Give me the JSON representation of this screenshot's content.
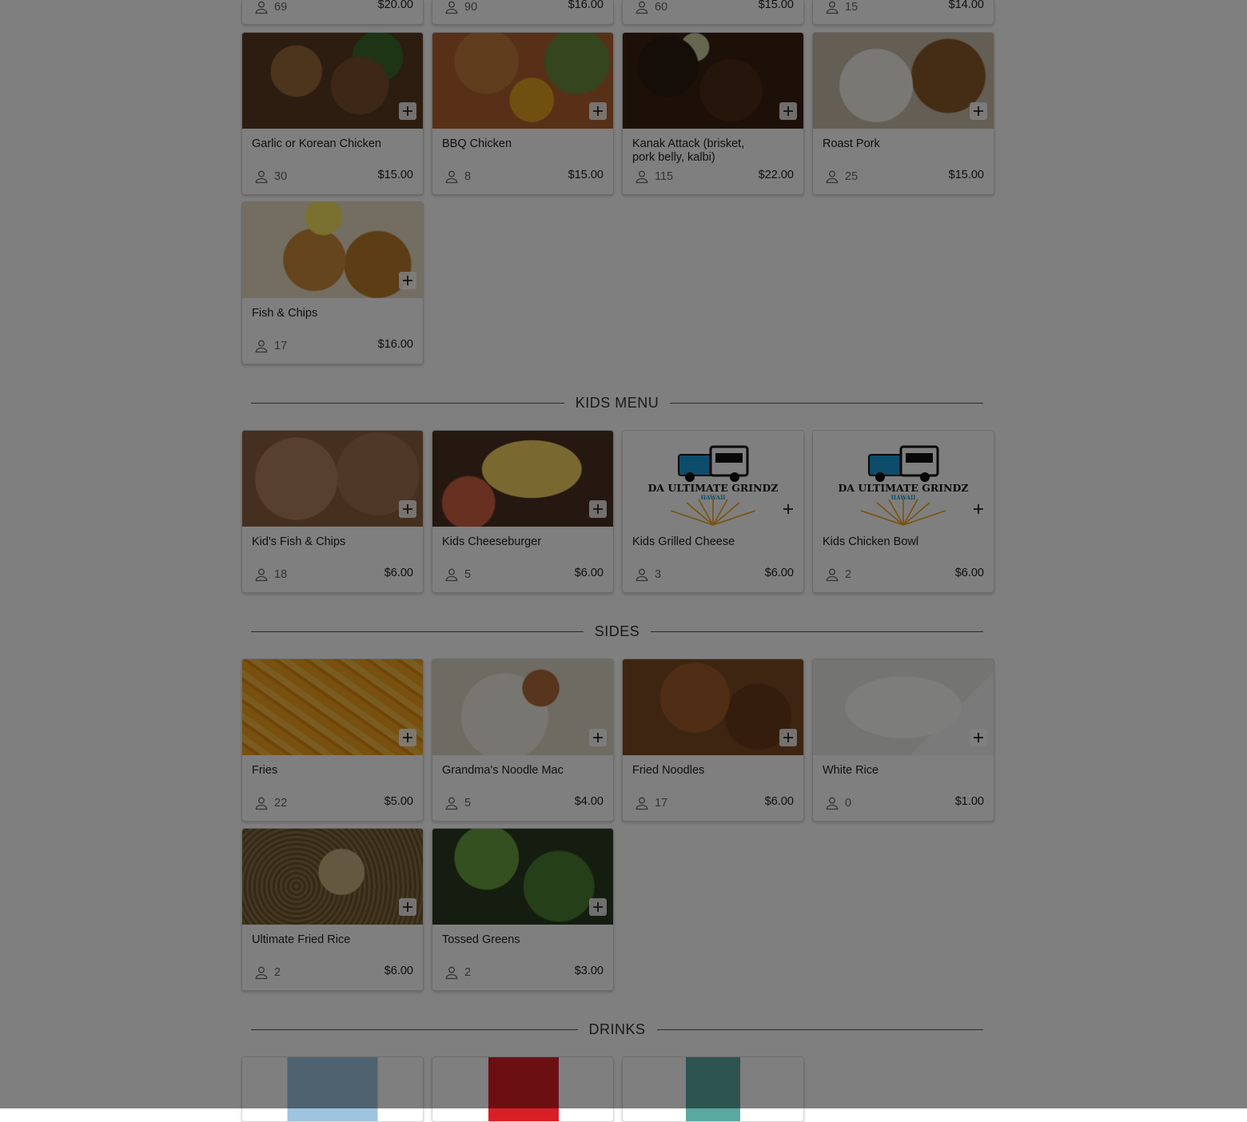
{
  "top_row": [
    {
      "count": "69",
      "price": "$20.00"
    },
    {
      "count": "90",
      "price": "$16.00"
    },
    {
      "count": "60",
      "price": "$15.00"
    },
    {
      "count": "15",
      "price": "$14.00"
    }
  ],
  "mains": [
    {
      "name": "Garlic or Korean Chicken",
      "count": "30",
      "price": "$15.00"
    },
    {
      "name": "BBQ Chicken",
      "count": "8",
      "price": "$15.00"
    },
    {
      "name": "Kanak Attack (brisket, pork belly, kalbi)",
      "count": "115",
      "price": "$22.00"
    },
    {
      "name": "Roast Pork",
      "count": "25",
      "price": "$15.00"
    },
    {
      "name": "Fish & Chips",
      "count": "17",
      "price": "$16.00"
    }
  ],
  "kids_menu": {
    "title": "KIDS MENU",
    "items": [
      {
        "name": "Kid's Fish & Chips",
        "count": "18",
        "price": "$6.00"
      },
      {
        "name": "Kids Cheeseburger",
        "count": "5",
        "price": "$6.00"
      },
      {
        "name": "Kids Grilled Cheese",
        "count": "3",
        "price": "$6.00"
      },
      {
        "name": "Kids Chicken Bowl",
        "count": "2",
        "price": "$6.00"
      }
    ]
  },
  "sides": {
    "title": "SIDES",
    "items": [
      {
        "name": "Fries",
        "count": "22",
        "price": "$5.00"
      },
      {
        "name": "Grandma's Noodle Mac",
        "count": "5",
        "price": "$4.00"
      },
      {
        "name": "Fried Noodles",
        "count": "17",
        "price": "$6.00"
      },
      {
        "name": "White Rice",
        "count": "0",
        "price": "$1.00"
      },
      {
        "name": "Ultimate Fried Rice",
        "count": "2",
        "price": "$6.00"
      },
      {
        "name": "Tossed Greens",
        "count": "2",
        "price": "$3.00"
      }
    ]
  },
  "drinks": {
    "title": "DRINKS"
  },
  "logo": {
    "text": "DA ULTIMATE GRINDZ",
    "subtext": "HAWAII"
  },
  "icons": {
    "add": "plus-icon",
    "count": "person-icon"
  },
  "colors": {
    "overlay": "#000000",
    "overlay_opacity": 0.5,
    "card_border": "#d8d8d8"
  }
}
